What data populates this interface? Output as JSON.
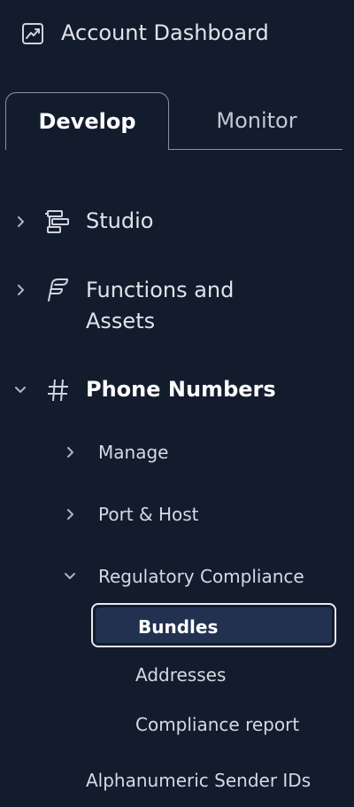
{
  "header": {
    "dashboard_label": "Account Dashboard"
  },
  "tabs": [
    {
      "label": "Develop",
      "active": true
    },
    {
      "label": "Monitor",
      "active": false
    }
  ],
  "nav": {
    "studio": {
      "label": "Studio",
      "expanded": false
    },
    "functions": {
      "label_line1": "Functions and",
      "label_line2": "Assets",
      "expanded": false
    },
    "phone_numbers": {
      "label": "Phone Numbers",
      "expanded": true,
      "children": {
        "manage": {
          "label": "Manage",
          "expanded": false
        },
        "port_host": {
          "label": "Port & Host",
          "expanded": false
        },
        "regulatory": {
          "label": "Regulatory Compliance",
          "expanded": true,
          "children": {
            "bundles": {
              "label": "Bundles",
              "selected": true
            },
            "addresses": {
              "label": "Addresses"
            },
            "compliance_report": {
              "label": "Compliance report"
            }
          }
        }
      }
    },
    "alphanumeric": {
      "label": "Alphanumeric Sender IDs"
    }
  },
  "colors": {
    "background": "#121c2d",
    "text": "#e1e3ea",
    "selected_bg": "#223150",
    "selected_border": "#e8ebf1"
  },
  "icons": {
    "dashboard": "chart-trend-icon",
    "studio": "studio-flow-icon",
    "functions": "functions-feather-icon",
    "phone_numbers": "hash-icon",
    "chevron_right": "chevron-right-icon",
    "chevron_down": "chevron-down-icon"
  }
}
